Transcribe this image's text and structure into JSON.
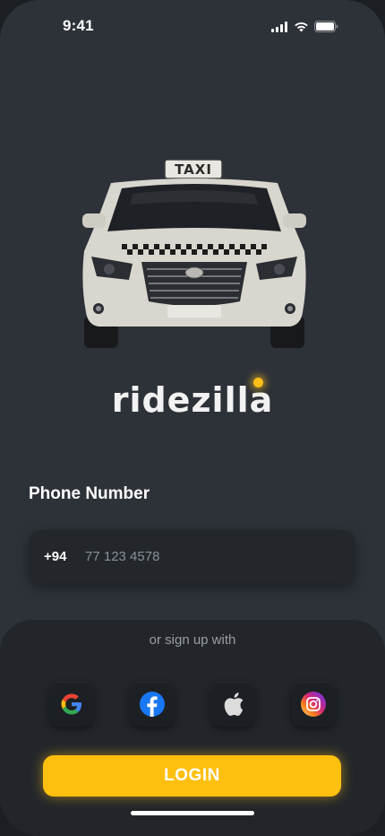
{
  "status_bar": {
    "time": "9:41",
    "icons": [
      "signal-icon",
      "wifi-icon",
      "battery-icon"
    ]
  },
  "taxi_sign": "TAXI",
  "brand": {
    "name": "ridezilla",
    "dot_color": "#ffbf1a"
  },
  "phone_number": {
    "label": "Phone Number",
    "country_code": "+94",
    "placeholder": "77 123 4578"
  },
  "signup": {
    "prompt": "or sign up with",
    "providers": [
      "google-icon",
      "facebook-icon",
      "apple-icon",
      "instagram-icon"
    ]
  },
  "login_label": "LOGIN",
  "colors": {
    "accent": "#ffbf0f",
    "background": "#2d3239",
    "sheet": "#22262b"
  }
}
